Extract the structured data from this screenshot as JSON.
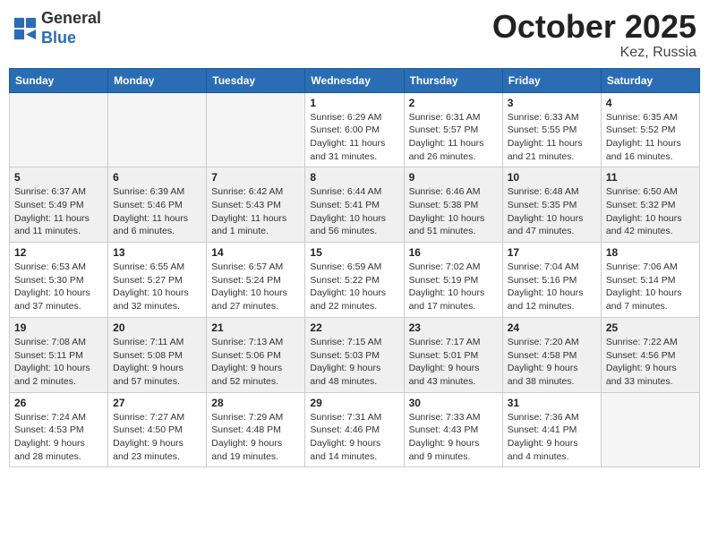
{
  "header": {
    "logo_line1": "General",
    "logo_line2": "Blue",
    "month": "October 2025",
    "location": "Kez, Russia"
  },
  "days_of_week": [
    "Sunday",
    "Monday",
    "Tuesday",
    "Wednesday",
    "Thursday",
    "Friday",
    "Saturday"
  ],
  "weeks": [
    [
      {
        "day": "",
        "info": ""
      },
      {
        "day": "",
        "info": ""
      },
      {
        "day": "",
        "info": ""
      },
      {
        "day": "1",
        "info": "Sunrise: 6:29 AM\nSunset: 6:00 PM\nDaylight: 11 hours\nand 31 minutes."
      },
      {
        "day": "2",
        "info": "Sunrise: 6:31 AM\nSunset: 5:57 PM\nDaylight: 11 hours\nand 26 minutes."
      },
      {
        "day": "3",
        "info": "Sunrise: 6:33 AM\nSunset: 5:55 PM\nDaylight: 11 hours\nand 21 minutes."
      },
      {
        "day": "4",
        "info": "Sunrise: 6:35 AM\nSunset: 5:52 PM\nDaylight: 11 hours\nand 16 minutes."
      }
    ],
    [
      {
        "day": "5",
        "info": "Sunrise: 6:37 AM\nSunset: 5:49 PM\nDaylight: 11 hours\nand 11 minutes."
      },
      {
        "day": "6",
        "info": "Sunrise: 6:39 AM\nSunset: 5:46 PM\nDaylight: 11 hours\nand 6 minutes."
      },
      {
        "day": "7",
        "info": "Sunrise: 6:42 AM\nSunset: 5:43 PM\nDaylight: 11 hours\nand 1 minute."
      },
      {
        "day": "8",
        "info": "Sunrise: 6:44 AM\nSunset: 5:41 PM\nDaylight: 10 hours\nand 56 minutes."
      },
      {
        "day": "9",
        "info": "Sunrise: 6:46 AM\nSunset: 5:38 PM\nDaylight: 10 hours\nand 51 minutes."
      },
      {
        "day": "10",
        "info": "Sunrise: 6:48 AM\nSunset: 5:35 PM\nDaylight: 10 hours\nand 47 minutes."
      },
      {
        "day": "11",
        "info": "Sunrise: 6:50 AM\nSunset: 5:32 PM\nDaylight: 10 hours\nand 42 minutes."
      }
    ],
    [
      {
        "day": "12",
        "info": "Sunrise: 6:53 AM\nSunset: 5:30 PM\nDaylight: 10 hours\nand 37 minutes."
      },
      {
        "day": "13",
        "info": "Sunrise: 6:55 AM\nSunset: 5:27 PM\nDaylight: 10 hours\nand 32 minutes."
      },
      {
        "day": "14",
        "info": "Sunrise: 6:57 AM\nSunset: 5:24 PM\nDaylight: 10 hours\nand 27 minutes."
      },
      {
        "day": "15",
        "info": "Sunrise: 6:59 AM\nSunset: 5:22 PM\nDaylight: 10 hours\nand 22 minutes."
      },
      {
        "day": "16",
        "info": "Sunrise: 7:02 AM\nSunset: 5:19 PM\nDaylight: 10 hours\nand 17 minutes."
      },
      {
        "day": "17",
        "info": "Sunrise: 7:04 AM\nSunset: 5:16 PM\nDaylight: 10 hours\nand 12 minutes."
      },
      {
        "day": "18",
        "info": "Sunrise: 7:06 AM\nSunset: 5:14 PM\nDaylight: 10 hours\nand 7 minutes."
      }
    ],
    [
      {
        "day": "19",
        "info": "Sunrise: 7:08 AM\nSunset: 5:11 PM\nDaylight: 10 hours\nand 2 minutes."
      },
      {
        "day": "20",
        "info": "Sunrise: 7:11 AM\nSunset: 5:08 PM\nDaylight: 9 hours\nand 57 minutes."
      },
      {
        "day": "21",
        "info": "Sunrise: 7:13 AM\nSunset: 5:06 PM\nDaylight: 9 hours\nand 52 minutes."
      },
      {
        "day": "22",
        "info": "Sunrise: 7:15 AM\nSunset: 5:03 PM\nDaylight: 9 hours\nand 48 minutes."
      },
      {
        "day": "23",
        "info": "Sunrise: 7:17 AM\nSunset: 5:01 PM\nDaylight: 9 hours\nand 43 minutes."
      },
      {
        "day": "24",
        "info": "Sunrise: 7:20 AM\nSunset: 4:58 PM\nDaylight: 9 hours\nand 38 minutes."
      },
      {
        "day": "25",
        "info": "Sunrise: 7:22 AM\nSunset: 4:56 PM\nDaylight: 9 hours\nand 33 minutes."
      }
    ],
    [
      {
        "day": "26",
        "info": "Sunrise: 7:24 AM\nSunset: 4:53 PM\nDaylight: 9 hours\nand 28 minutes."
      },
      {
        "day": "27",
        "info": "Sunrise: 7:27 AM\nSunset: 4:50 PM\nDaylight: 9 hours\nand 23 minutes."
      },
      {
        "day": "28",
        "info": "Sunrise: 7:29 AM\nSunset: 4:48 PM\nDaylight: 9 hours\nand 19 minutes."
      },
      {
        "day": "29",
        "info": "Sunrise: 7:31 AM\nSunset: 4:46 PM\nDaylight: 9 hours\nand 14 minutes."
      },
      {
        "day": "30",
        "info": "Sunrise: 7:33 AM\nSunset: 4:43 PM\nDaylight: 9 hours\nand 9 minutes."
      },
      {
        "day": "31",
        "info": "Sunrise: 7:36 AM\nSunset: 4:41 PM\nDaylight: 9 hours\nand 4 minutes."
      },
      {
        "day": "",
        "info": ""
      }
    ]
  ]
}
